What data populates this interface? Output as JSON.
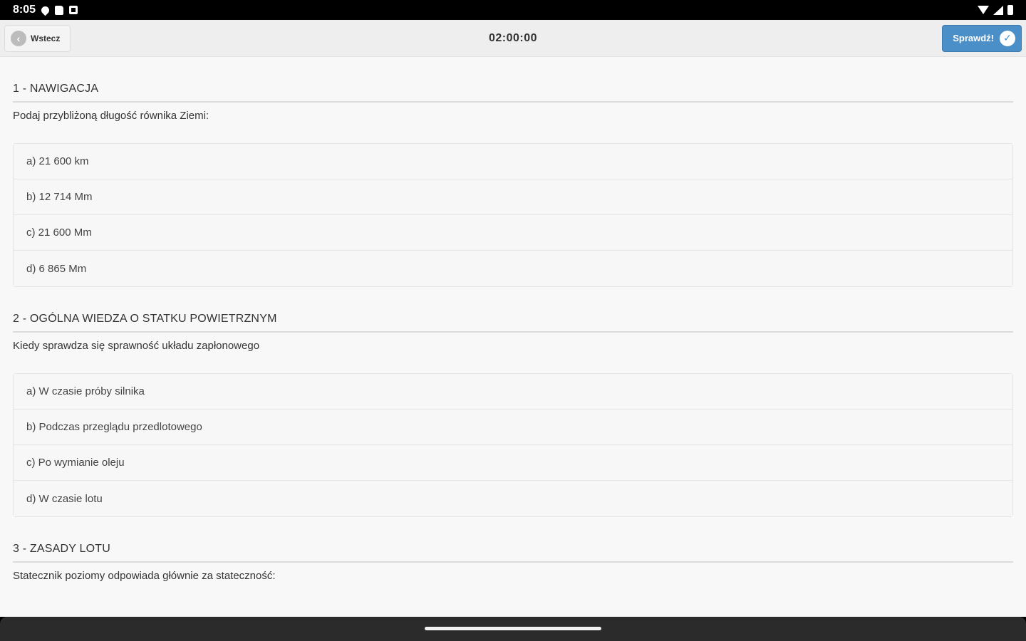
{
  "status_bar": {
    "time": "8:05",
    "left_icons": [
      "shield-icon",
      "sd-card-icon",
      "notification-square-icon"
    ],
    "right_icons": [
      "wifi-icon",
      "signal-icon",
      "battery-icon"
    ]
  },
  "toolbar": {
    "back_label": "Wstecz",
    "timer": "02:00:00",
    "check_label": "Sprawdź!"
  },
  "questions": [
    {
      "title": "1 - NAWIGACJA",
      "text": "Podaj przybliżoną długość równika Ziemi:",
      "answers": [
        "a) 21 600 km",
        "b) 12 714 Mm",
        "c) 21 600 Mm",
        "d) 6 865 Mm"
      ]
    },
    {
      "title": "2 - OGÓLNA WIEDZA O STATKU POWIETRZNYM",
      "text": "Kiedy sprawdza się sprawność układu zapłonowego",
      "answers": [
        "a) W czasie próby silnika",
        "b) Podczas przeglądu przedlotowego",
        "c) Po wymianie oleju",
        "d) W czasie lotu"
      ]
    },
    {
      "title": "3 - ZASADY LOTU",
      "text": "Statecznik poziomy odpowiada głównie za stateczność:"
    }
  ],
  "colors": {
    "accent": "#4a8fc7",
    "background": "#f8f8f8",
    "toolbar": "#eeeeee"
  }
}
